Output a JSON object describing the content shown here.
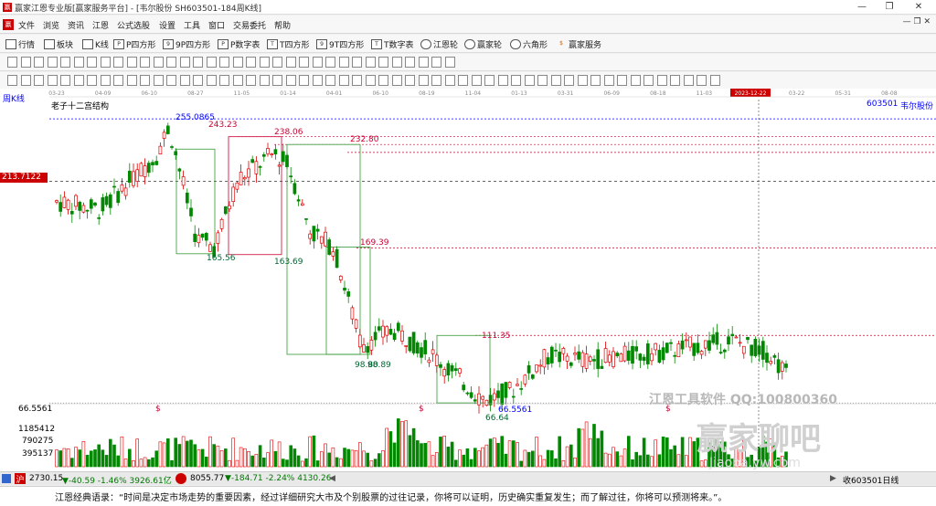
{
  "window": {
    "title": "赢家江恩专业版[赢家服务平台] - [韦尔股份  SH603501-184周K线]"
  },
  "menu": [
    "文件",
    "浏览",
    "资讯",
    "江恩",
    "公式选股",
    "设置",
    "工具",
    "窗口",
    "交易委托",
    "帮助"
  ],
  "toolbar": [
    {
      "label": "行情",
      "icon": "grid-icon"
    },
    {
      "label": "板块",
      "icon": "grid-icon"
    },
    {
      "label": "K线",
      "icon": "candles-icon"
    },
    {
      "label": "P四方形",
      "icon": "square-icon"
    },
    {
      "label": "9P四方形",
      "icon": "square-icon"
    },
    {
      "label": "P数字表",
      "icon": "table-icon"
    },
    {
      "label": "T四方形",
      "icon": "square-icon"
    },
    {
      "label": "9T四方形",
      "icon": "square-icon"
    },
    {
      "label": "T数字表",
      "icon": "table-icon"
    },
    {
      "label": "江恩轮",
      "icon": "wheel-icon"
    },
    {
      "label": "赢家轮",
      "icon": "wheel-icon"
    },
    {
      "label": "六角形",
      "icon": "hexagon-icon"
    },
    {
      "label": "赢家服务",
      "icon": "dollar-icon"
    }
  ],
  "chart": {
    "period_label": "周K线",
    "pattern_label": "老子十二宫结构",
    "stock_code": "603501",
    "stock_name": "韦尔股份",
    "date_ticks": [
      "03-23",
      "04-09",
      "06-10",
      "08-27",
      "11-05",
      "01-14",
      "04-01",
      "06-10",
      "08-19",
      "11-04",
      "01-13",
      "03-31",
      "06-09",
      "08-18",
      "11-03",
      "2023-12-22",
      "03-22",
      "05-31",
      "08-08"
    ],
    "price_tag": "213.7122",
    "bottom_price": "66.5561",
    "annotations": [
      "255.0865",
      "243.23",
      "238.06",
      "232.80",
      "169.39",
      "165.56",
      "163.69",
      "111.35",
      "98.80",
      "98.89",
      "66.5561",
      "66.64"
    ],
    "volume_ticks": [
      "1185412",
      "790275",
      "395137"
    ],
    "watermark": "江恩工具软件  QQ:100800360",
    "watermark2": "赢家聊吧",
    "watermark3": "Jiaoba.yw.com",
    "markers": [
      "$",
      "$",
      "$"
    ],
    "chart_data": {
      "type": "candlestick",
      "title": "老子十二宫结构",
      "series": [
        {
          "name": "韦尔股份",
          "values": [
            255.0865,
            243.23,
            238.06,
            232.8,
            169.39,
            165.56,
            163.69,
            111.35,
            98.8,
            66.5561,
            66.64
          ]
        }
      ]
    }
  },
  "status": {
    "idx1_val": "2730.15",
    "idx1_chg": "▼-40.59 -1.46% 3926.61亿",
    "idx2_val": "8055.77",
    "idx2_chg": "▼-184.71 -2.24% 4130.26",
    "right": "收603501日线"
  },
  "quote": "江恩经典语录：“时间是决定市场走势的重要因素，经过详细研究大市及个别股票的过往记录，你将可以证明，历史确实重复发生；而了解过往，你将可以预测将来。”。"
}
